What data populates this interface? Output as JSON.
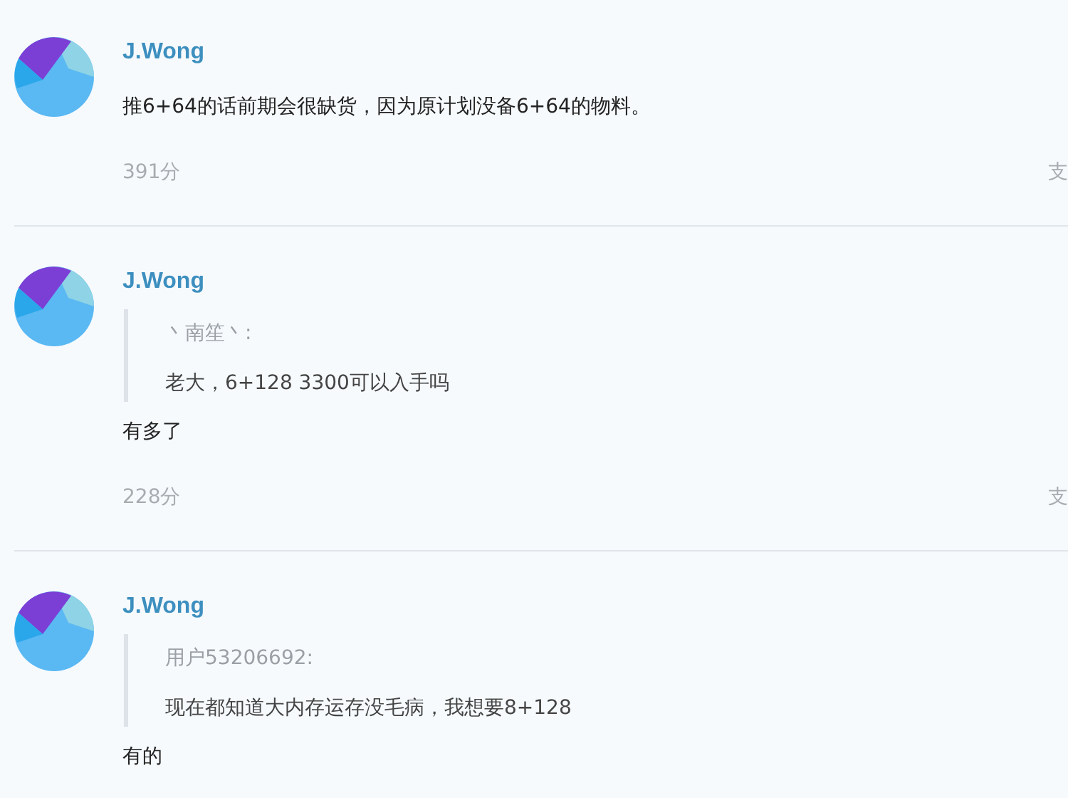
{
  "comments": [
    {
      "author": "J.Wong",
      "text": "推6+64的话前期会很缺货，因为原计划没备6+64的物料。",
      "score": "391分",
      "action": "支"
    },
    {
      "author": "J.Wong",
      "quote": {
        "author": "丶南笙丶:",
        "text": "老大，6+128 3300可以入手吗"
      },
      "text": "有多了",
      "score": "228分",
      "action": "支"
    },
    {
      "author": "J.Wong",
      "quote": {
        "author": "用户53206692:",
        "text": "现在都知道大内存运存没毛病，我想要8+128"
      },
      "text": "有的"
    }
  ]
}
